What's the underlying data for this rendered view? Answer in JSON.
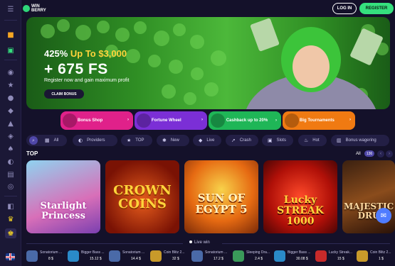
{
  "header": {
    "logo_text": "WIN BERRY",
    "login_label": "LOG IN",
    "register_label": "REGISTER"
  },
  "sidebar": {
    "icons": [
      "menu-icon",
      "gift-icon",
      "calendar-icon",
      "coins-icon",
      "star-icon",
      "flame-icon",
      "gamepad-icon",
      "rocket-icon",
      "dice-icon",
      "cards-icon",
      "bell-icon",
      "table-icon",
      "support-icon",
      "chat-icon",
      "trophy-icon",
      "trophy-cup-icon"
    ]
  },
  "hero": {
    "bonus_prefix": "425%",
    "bonus_accent": "Up To $3,000",
    "free_spins": "+ 675 FS",
    "subtitle": "Register now and gain maximum profit",
    "cta_label": "CLAIM BONUS"
  },
  "promos": [
    {
      "label": "Bonus Shop",
      "color": "#e0218a"
    },
    {
      "label": "Fortune Wheel",
      "color": "#7b2fd6"
    },
    {
      "label": "Cashback up to 20%",
      "color": "#1fb657"
    },
    {
      "label": "Big Tournaments",
      "color": "#f07a12"
    }
  ],
  "categories": [
    {
      "label": "All",
      "icon": "grid-icon"
    },
    {
      "label": "Providers",
      "icon": "providers-icon"
    },
    {
      "label": "TOP",
      "icon": "star-icon"
    },
    {
      "label": "New",
      "icon": "new-icon"
    },
    {
      "label": "Live",
      "icon": "live-icon"
    },
    {
      "label": "Crash",
      "icon": "crash-icon"
    },
    {
      "label": "Slots",
      "icon": "slots-icon"
    },
    {
      "label": "Hot",
      "icon": "hot-icon"
    },
    {
      "label": "Bonus wagering",
      "icon": "bonus-icon"
    }
  ],
  "top_section": {
    "title": "TOP",
    "all_label": "All",
    "count": "136"
  },
  "games": [
    {
      "name": "Starlight Princess"
    },
    {
      "name": "CROWN COINS"
    },
    {
      "name": "SUN OF EGYPT 5"
    },
    {
      "name": "Lucky STREAK 1000"
    },
    {
      "name": "MAJESTIC DRU"
    }
  ],
  "live_win": {
    "label": "Live win",
    "items": [
      {
        "game": "Sonatorium ...",
        "amount": "8 $"
      },
      {
        "game": "Bigger Bass ...",
        "amount": "15.12 $"
      },
      {
        "game": "Sonatorium ...",
        "amount": "14.4 $"
      },
      {
        "game": "Coin Blitz 2...",
        "amount": "32 $"
      },
      {
        "game": "Sonatorium ...",
        "amount": "17.2 $"
      },
      {
        "game": "Sleeping Dra...",
        "amount": "2.4 $"
      },
      {
        "game": "Bigger Bass ...",
        "amount": "30.08 $"
      },
      {
        "game": "Lucky Streak...",
        "amount": "15 $"
      },
      {
        "game": "Coin Blitz 2...",
        "amount": "1 $"
      }
    ]
  },
  "colors": {
    "background": "#14112a",
    "register": "#35e07e",
    "accent": "#ffd43b",
    "chip": "#231f45"
  }
}
